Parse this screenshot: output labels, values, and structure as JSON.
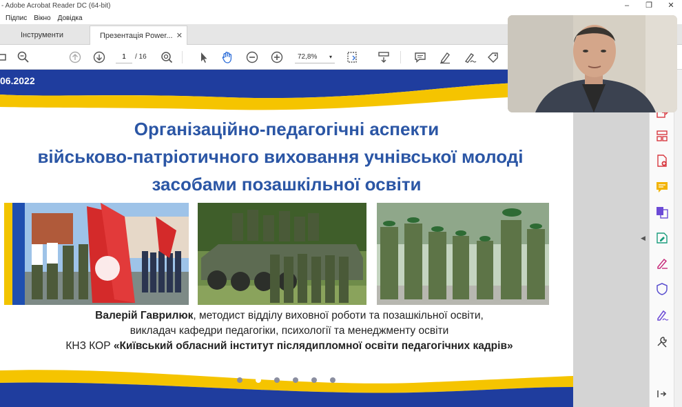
{
  "window": {
    "title": "- Adobe Acrobat Reader DC (64-bit)",
    "controls": [
      "–",
      "❐",
      "✕"
    ]
  },
  "menu": {
    "items": [
      "Підпис",
      "Вікно",
      "Довідка"
    ]
  },
  "tabs": {
    "tools_label": "Інструменти",
    "doc_label": "Презентація Power...",
    "close_glyph": "✕"
  },
  "toolbar": {
    "page_current": "1",
    "page_total": "/ 16",
    "zoom": "72,8%",
    "zoom_caret": "▾"
  },
  "slide": {
    "date": "06.2022",
    "title_line1": "Організаційно-педагогічні аспекти",
    "title_line2": "військово-патріотичного виховання учнівської молоді",
    "title_line3": "засобами позашкільної освіти",
    "author_name": "Валерій Гаврилюк",
    "author_role1": ", методист відділу виховної роботи та позашкільної освіти,",
    "author_role2": "викладач кафедри педагогіки, психології та менеджменту освіти",
    "org_prefix": "КНЗ КОР ",
    "org_name": "«Київський обласний інститут післядипломної освіти педагогічних кадрів»",
    "dot_count": 6,
    "active_dot": 1
  },
  "colors": {
    "brand_blue": "#2b56a5",
    "stripe_yellow": "#f5c400",
    "stripe_blue": "#1f3d9e",
    "acrobat_red": "#d7373f"
  },
  "sidebar_icons": [
    "export-pdf-icon",
    "organize-pages-icon",
    "create-pdf-icon",
    "comment-icon",
    "combine-files-icon",
    "edit-pdf-icon",
    "fill-sign-icon",
    "protect-icon",
    "sign-icon",
    "more-tools-icon",
    "collapse-panel-icon"
  ]
}
